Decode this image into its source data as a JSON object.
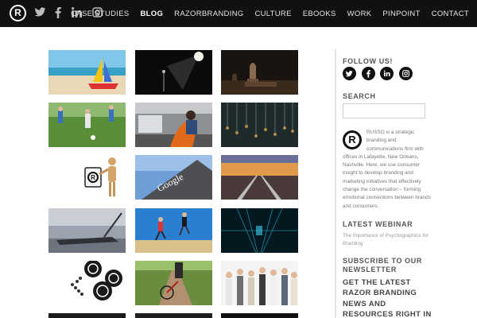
{
  "header": {
    "logo_symbol": "R",
    "social_icons": [
      "twitter-icon",
      "facebook-icon",
      "linkedin-icon",
      "instagram-icon"
    ],
    "nav": [
      {
        "label": "CASE STUDIES",
        "active": false
      },
      {
        "label": "BLOG",
        "active": true
      },
      {
        "label": "RAZORBRANDING",
        "active": false
      },
      {
        "label": "CULTURE",
        "active": false
      },
      {
        "label": "EBOOKS",
        "active": false
      },
      {
        "label": "WORK",
        "active": false
      },
      {
        "label": "PINPOINT",
        "active": false
      },
      {
        "label": "CONTACT",
        "active": false
      }
    ]
  },
  "grid": {
    "tiles": [
      {
        "subject": "beach-sailboat"
      },
      {
        "subject": "spotlight-microphone"
      },
      {
        "subject": "chess-pieces"
      },
      {
        "subject": "soccer-players"
      },
      {
        "subject": "woman-at-computer"
      },
      {
        "subject": "hanging-keys"
      },
      {
        "subject": "wooden-mannequin-r-card"
      },
      {
        "subject": "google-sign"
      },
      {
        "subject": "railroad-sunset"
      },
      {
        "subject": "shipwreck"
      },
      {
        "subject": "people-jumping"
      },
      {
        "subject": "tech-tunnel"
      },
      {
        "subject": "poker-chips"
      },
      {
        "subject": "bicycle-path"
      },
      {
        "subject": "group-of-people"
      }
    ],
    "google_sign_text": "Google"
  },
  "sidebar": {
    "follow_heading": "FOLLOW US!",
    "social_icons": [
      "twitter-icon",
      "facebook-icon",
      "linkedin-icon",
      "instagram-icon"
    ],
    "search_heading": "SEARCH",
    "search_value": "",
    "about_logo": "R",
    "about_text": "RUSSO is a strategic branding and communications firm with offices in Lafayette, New Orleans, Nashville. Here, we use consumer insight to develop branding and marketing initiatives that effectively change the conversation – forming emotional connections between brands and consumers.",
    "webinar_heading": "LATEST WEBINAR",
    "webinar_link": "The Importance of Psychographics for Branding",
    "newsletter_heading": "SUBSCRIBE TO OUR NEWSLETTER",
    "newsletter_cta": "GET THE LATEST RAZOR BRANDING NEWS AND RESOURCES RIGHT IN YOUR INBOX!"
  },
  "colors": {
    "header_bg": "#111111",
    "sidebar_rule": "#e3e3e3"
  }
}
